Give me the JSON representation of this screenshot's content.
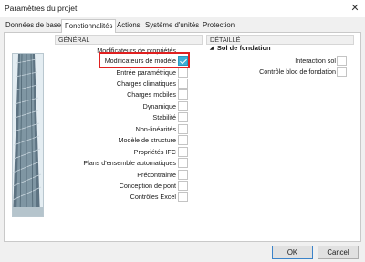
{
  "window": {
    "title": "Paramètres du projet",
    "close_glyph": "✕"
  },
  "tabs": [
    {
      "label": "Données de base"
    },
    {
      "label": "Fonctionnalités",
      "active": true
    },
    {
      "label": "Actions"
    },
    {
      "label": "Système d'unités"
    },
    {
      "label": "Protection"
    }
  ],
  "general": {
    "header": "GÉNÉRAL",
    "items": [
      {
        "label": "Modificateurs de propriétés",
        "checked": null
      },
      {
        "label": "Modificateurs de modèle",
        "checked": true,
        "highlighted": true
      },
      {
        "label": "Entrée paramétrique",
        "checked": false
      },
      {
        "label": "Charges climatiques",
        "checked": false
      },
      {
        "label": "Charges mobiles",
        "checked": false
      },
      {
        "label": "Dynamique",
        "checked": false
      },
      {
        "label": "Stabilité",
        "checked": false
      },
      {
        "label": "Non-linéarités",
        "checked": false
      },
      {
        "label": "Modèle de structure",
        "checked": false
      },
      {
        "label": "Propriétés IFC",
        "checked": false
      },
      {
        "label": "Plans d'ensemble automatiques",
        "checked": false
      },
      {
        "label": "Précontrainte",
        "checked": false
      },
      {
        "label": "Conception de pont",
        "checked": false
      },
      {
        "label": "Contrôles Excel",
        "checked": false
      }
    ]
  },
  "detail": {
    "header": "DÉTAILLÉ",
    "group_title": "Sol de fondation",
    "group_icon": "◢",
    "items": [
      {
        "label": "Interaction sol",
        "checked": false
      },
      {
        "label": "Contrôle bloc de fondation",
        "checked": false
      }
    ]
  },
  "footer": {
    "ok_label": "OK",
    "cancel_label": "Cancel"
  },
  "colors": {
    "accent": "#3cb0d8",
    "highlight": "#e02020"
  }
}
